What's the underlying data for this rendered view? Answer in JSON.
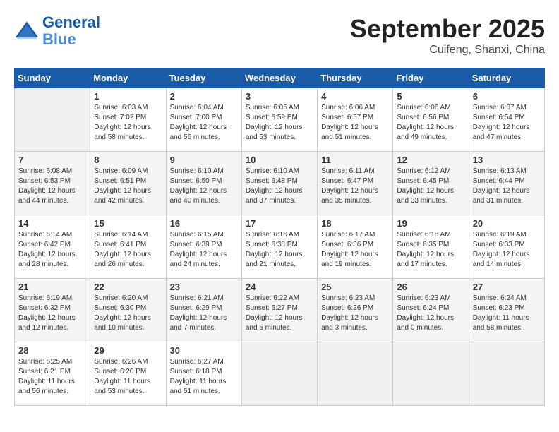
{
  "header": {
    "logo_line1": "General",
    "logo_line2": "Blue",
    "month": "September 2025",
    "location": "Cuifeng, Shanxi, China"
  },
  "days_of_week": [
    "Sunday",
    "Monday",
    "Tuesday",
    "Wednesday",
    "Thursday",
    "Friday",
    "Saturday"
  ],
  "weeks": [
    [
      {
        "day": "",
        "empty": true
      },
      {
        "day": "1",
        "sunrise": "6:03 AM",
        "sunset": "7:02 PM",
        "daylight": "12 hours and 58 minutes."
      },
      {
        "day": "2",
        "sunrise": "6:04 AM",
        "sunset": "7:00 PM",
        "daylight": "12 hours and 56 minutes."
      },
      {
        "day": "3",
        "sunrise": "6:05 AM",
        "sunset": "6:59 PM",
        "daylight": "12 hours and 53 minutes."
      },
      {
        "day": "4",
        "sunrise": "6:06 AM",
        "sunset": "6:57 PM",
        "daylight": "12 hours and 51 minutes."
      },
      {
        "day": "5",
        "sunrise": "6:06 AM",
        "sunset": "6:56 PM",
        "daylight": "12 hours and 49 minutes."
      },
      {
        "day": "6",
        "sunrise": "6:07 AM",
        "sunset": "6:54 PM",
        "daylight": "12 hours and 47 minutes."
      }
    ],
    [
      {
        "day": "7",
        "sunrise": "6:08 AM",
        "sunset": "6:53 PM",
        "daylight": "12 hours and 44 minutes."
      },
      {
        "day": "8",
        "sunrise": "6:09 AM",
        "sunset": "6:51 PM",
        "daylight": "12 hours and 42 minutes."
      },
      {
        "day": "9",
        "sunrise": "6:10 AM",
        "sunset": "6:50 PM",
        "daylight": "12 hours and 40 minutes."
      },
      {
        "day": "10",
        "sunrise": "6:10 AM",
        "sunset": "6:48 PM",
        "daylight": "12 hours and 37 minutes."
      },
      {
        "day": "11",
        "sunrise": "6:11 AM",
        "sunset": "6:47 PM",
        "daylight": "12 hours and 35 minutes."
      },
      {
        "day": "12",
        "sunrise": "6:12 AM",
        "sunset": "6:45 PM",
        "daylight": "12 hours and 33 minutes."
      },
      {
        "day": "13",
        "sunrise": "6:13 AM",
        "sunset": "6:44 PM",
        "daylight": "12 hours and 31 minutes."
      }
    ],
    [
      {
        "day": "14",
        "sunrise": "6:14 AM",
        "sunset": "6:42 PM",
        "daylight": "12 hours and 28 minutes."
      },
      {
        "day": "15",
        "sunrise": "6:14 AM",
        "sunset": "6:41 PM",
        "daylight": "12 hours and 26 minutes."
      },
      {
        "day": "16",
        "sunrise": "6:15 AM",
        "sunset": "6:39 PM",
        "daylight": "12 hours and 24 minutes."
      },
      {
        "day": "17",
        "sunrise": "6:16 AM",
        "sunset": "6:38 PM",
        "daylight": "12 hours and 21 minutes."
      },
      {
        "day": "18",
        "sunrise": "6:17 AM",
        "sunset": "6:36 PM",
        "daylight": "12 hours and 19 minutes."
      },
      {
        "day": "19",
        "sunrise": "6:18 AM",
        "sunset": "6:35 PM",
        "daylight": "12 hours and 17 minutes."
      },
      {
        "day": "20",
        "sunrise": "6:19 AM",
        "sunset": "6:33 PM",
        "daylight": "12 hours and 14 minutes."
      }
    ],
    [
      {
        "day": "21",
        "sunrise": "6:19 AM",
        "sunset": "6:32 PM",
        "daylight": "12 hours and 12 minutes."
      },
      {
        "day": "22",
        "sunrise": "6:20 AM",
        "sunset": "6:30 PM",
        "daylight": "12 hours and 10 minutes."
      },
      {
        "day": "23",
        "sunrise": "6:21 AM",
        "sunset": "6:29 PM",
        "daylight": "12 hours and 7 minutes."
      },
      {
        "day": "24",
        "sunrise": "6:22 AM",
        "sunset": "6:27 PM",
        "daylight": "12 hours and 5 minutes."
      },
      {
        "day": "25",
        "sunrise": "6:23 AM",
        "sunset": "6:26 PM",
        "daylight": "12 hours and 3 minutes."
      },
      {
        "day": "26",
        "sunrise": "6:23 AM",
        "sunset": "6:24 PM",
        "daylight": "12 hours and 0 minutes."
      },
      {
        "day": "27",
        "sunrise": "6:24 AM",
        "sunset": "6:23 PM",
        "daylight": "11 hours and 58 minutes."
      }
    ],
    [
      {
        "day": "28",
        "sunrise": "6:25 AM",
        "sunset": "6:21 PM",
        "daylight": "11 hours and 56 minutes."
      },
      {
        "day": "29",
        "sunrise": "6:26 AM",
        "sunset": "6:20 PM",
        "daylight": "11 hours and 53 minutes."
      },
      {
        "day": "30",
        "sunrise": "6:27 AM",
        "sunset": "6:18 PM",
        "daylight": "11 hours and 51 minutes."
      },
      {
        "day": "",
        "empty": true
      },
      {
        "day": "",
        "empty": true
      },
      {
        "day": "",
        "empty": true
      },
      {
        "day": "",
        "empty": true
      }
    ]
  ]
}
